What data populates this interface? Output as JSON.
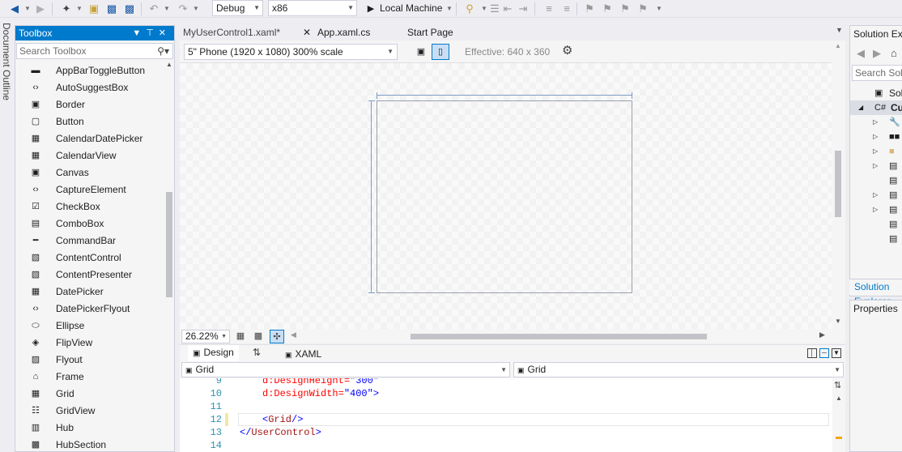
{
  "toolbar": {
    "config_value": "Debug",
    "platform_value": "x86",
    "run_target": "Local Machine"
  },
  "doc_outline_label": "Document Outline",
  "toolbox": {
    "title": "Toolbox",
    "search_placeholder": "Search Toolbox",
    "items": [
      {
        "label": "AppBarToggleButton",
        "icon": "toggle-icon"
      },
      {
        "label": "AutoSuggestBox",
        "icon": "code-icon"
      },
      {
        "label": "Border",
        "icon": "border-icon"
      },
      {
        "label": "Button",
        "icon": "button-icon"
      },
      {
        "label": "CalendarDatePicker",
        "icon": "calendar-icon"
      },
      {
        "label": "CalendarView",
        "icon": "calendar-icon"
      },
      {
        "label": "Canvas",
        "icon": "canvas-icon"
      },
      {
        "label": "CaptureElement",
        "icon": "code-icon"
      },
      {
        "label": "CheckBox",
        "icon": "checkbox-icon"
      },
      {
        "label": "ComboBox",
        "icon": "combobox-icon"
      },
      {
        "label": "CommandBar",
        "icon": "commandbar-icon"
      },
      {
        "label": "ContentControl",
        "icon": "content-icon"
      },
      {
        "label": "ContentPresenter",
        "icon": "content-icon"
      },
      {
        "label": "DatePicker",
        "icon": "calendar-icon"
      },
      {
        "label": "DatePickerFlyout",
        "icon": "code-icon"
      },
      {
        "label": "Ellipse",
        "icon": "ellipse-icon"
      },
      {
        "label": "FlipView",
        "icon": "flipview-icon"
      },
      {
        "label": "Flyout",
        "icon": "flyout-icon"
      },
      {
        "label": "Frame",
        "icon": "frame-icon"
      },
      {
        "label": "Grid",
        "icon": "grid-icon"
      },
      {
        "label": "GridView",
        "icon": "gridview-icon"
      },
      {
        "label": "Hub",
        "icon": "hub-icon"
      },
      {
        "label": "HubSection",
        "icon": "hubsection-icon"
      }
    ]
  },
  "tabs": [
    {
      "label": "MyUserControl1.xaml*",
      "active": true
    },
    {
      "label": "App.xaml.cs",
      "active": false
    },
    {
      "label": "Start Page",
      "active": false
    }
  ],
  "designer": {
    "device": "5\" Phone (1920 x 1080) 300% scale",
    "effective": "Effective: 640 x 360",
    "zoom": "26.22%",
    "design_tab": "Design",
    "xaml_tab": "XAML",
    "nav_left": "Grid",
    "nav_right": "Grid"
  },
  "code": {
    "lines": [
      {
        "num": "9",
        "parts": [
          {
            "t": "d:DesignHeight=",
            "c": "attr"
          },
          {
            "t": "\"300\"",
            "c": "str"
          }
        ]
      },
      {
        "num": "10",
        "parts": [
          {
            "t": "d:DesignWidth=",
            "c": "attr"
          },
          {
            "t": "\"400\"",
            "c": "str"
          },
          {
            "t": ">",
            "c": "brk"
          }
        ]
      },
      {
        "num": "11",
        "parts": []
      },
      {
        "num": "12",
        "parts": [
          {
            "t": "<",
            "c": "brk"
          },
          {
            "t": "Grid",
            "c": "tag"
          },
          {
            "t": "/>",
            "c": "brk"
          }
        ]
      },
      {
        "num": "13",
        "parts": [
          {
            "t": "</",
            "c": "brk"
          },
          {
            "t": "UserControl",
            "c": "tag"
          },
          {
            "t": ">",
            "c": "brk"
          }
        ]
      },
      {
        "num": "14",
        "parts": []
      }
    ]
  },
  "solution": {
    "title": "Solution Explorer",
    "search_placeholder": "Search Solution Explorer",
    "row1": "Solution",
    "row2": "Cu",
    "footer_tab": "Solution Explorer"
  },
  "properties": {
    "title": "Properties"
  },
  "colors": {
    "accent": "#007acc",
    "chrome": "#eeeef2"
  }
}
